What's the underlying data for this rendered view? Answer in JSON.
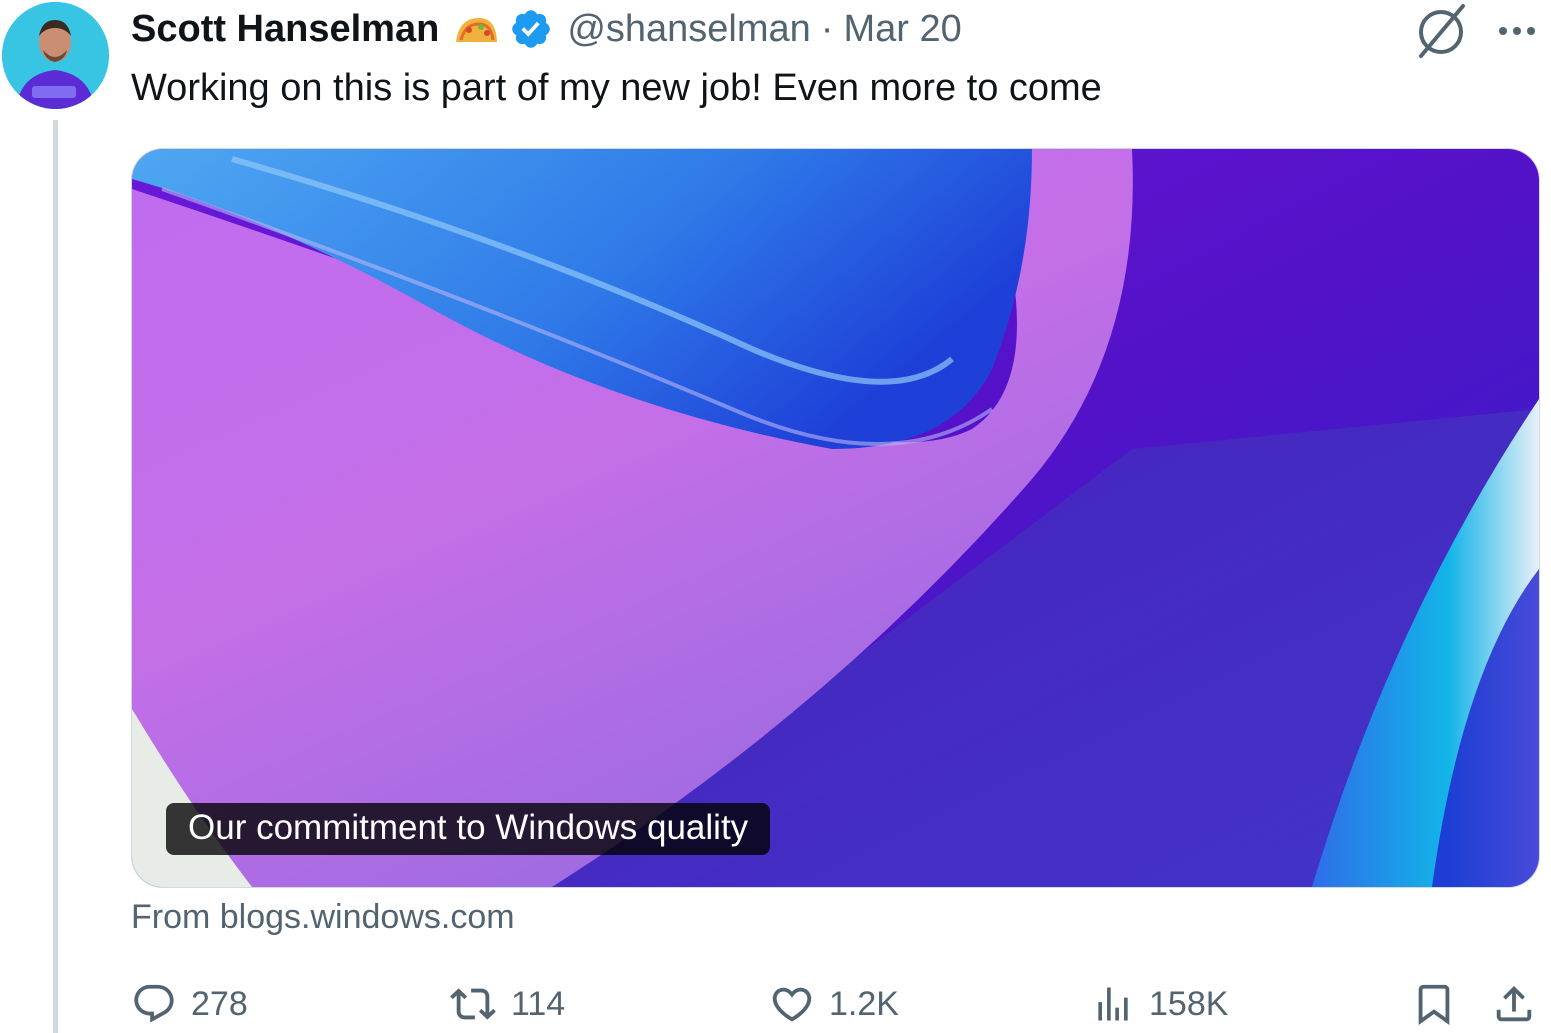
{
  "tweet": {
    "author_name": "Scott Hanselman",
    "handle": "@shanselman",
    "separator": "·",
    "date": "Mar 20",
    "text": "Working on this is part of my new job! Even more to come",
    "name_emoji_icon": "taco-icon",
    "verified_icon": "verified-badge-icon"
  },
  "top_actions": {
    "grok_icon": "grok-icon",
    "more_icon": "more-icon"
  },
  "card": {
    "caption": "Our commitment to Windows quality",
    "source": "From blogs.windows.com"
  },
  "actions": {
    "replies": "278",
    "reposts": "114",
    "likes": "1.2K",
    "views": "158K"
  },
  "colors": {
    "secondary_text": "#536471",
    "verified_blue": "#1d9bf0",
    "avatar_bg": "#37c5e3",
    "thread_line": "#cfd9de"
  }
}
